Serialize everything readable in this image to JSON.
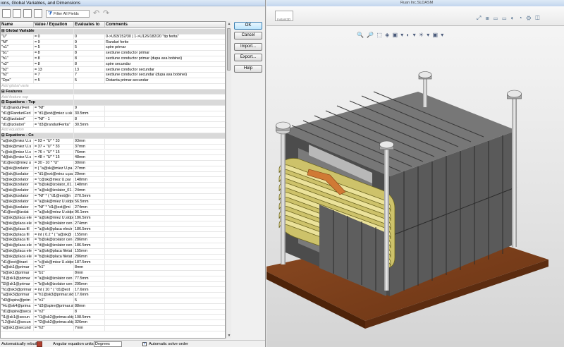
{
  "dialog": {
    "title": "ions, Global Variables, and Dimensions",
    "filter_placeholder": "Filter All Fields",
    "columns": [
      "Name",
      "Value / Equation",
      "Evaluates to",
      "Comments"
    ],
    "buttons": {
      "ok": "OK",
      "cancel": "Cancel",
      "import": "Import...",
      "export": "Export...",
      "help": "Help"
    },
    "bottom": {
      "automatic_label": "Automatically rebuild",
      "angular_units_label": "Angular equation units:",
      "angular_units_value": "Degrees",
      "auto_solve_label": "Automatic solve order"
    },
    "rows": [
      {
        "t": "section",
        "n": "Global Variable"
      },
      {
        "n": "\"U\"",
        "v": "= 0",
        "e": "0",
        "c": "0->U93/152/30 | 1->U126/182/20 \"tip ferita\""
      },
      {
        "n": "\"Nf\"",
        "v": "= 9",
        "e": "9",
        "c": "Randuri ferite"
      },
      {
        "n": "\"n1\"",
        "v": "= 5",
        "e": "5",
        "c": "spire primar"
      },
      {
        "n": "\"b1\"",
        "v": "= 8",
        "e": "8",
        "c": "sectiune conductor primar"
      },
      {
        "n": "\"h1\"",
        "v": "= 8",
        "e": "8",
        "c": "sectiune conductor primar (dupa axa bobinei)"
      },
      {
        "n": "\"n2\"",
        "v": "= 8",
        "e": "8",
        "c": "spire secundar"
      },
      {
        "n": "\"b2\"",
        "v": "= 13",
        "e": "13",
        "c": "sectiune conductor secundar"
      },
      {
        "n": "\"h2\"",
        "v": "= 7",
        "e": "7",
        "c": "sectiune conductor secundar (dupa axa bobinei)"
      },
      {
        "n": "\"Dps\"",
        "v": "= 5",
        "e": "5",
        "c": "Distanta primar-secundar"
      },
      {
        "t": "add",
        "n": "Add global varia"
      },
      {
        "t": "section",
        "n": "Features"
      },
      {
        "t": "add",
        "n": "Add feature sup"
      },
      {
        "t": "section",
        "n": "Equations - Top"
      },
      {
        "n": "\"d1@randuriFeri",
        "v": "= \"Nf\"",
        "e": "9",
        "c": ""
      },
      {
        "n": "\"d1@RanduriFeri",
        "v": "= \"d1@ext@miez u.sk",
        "e": "30.5mm",
        "c": ""
      },
      {
        "n": "\"d1@izolatori\"",
        "v": "= \"Nf\" - 1",
        "e": "8",
        "c": ""
      },
      {
        "n": "\"d1@izolatori\"",
        "v": "= \"d3@randuriFerita\"",
        "e": "30.5mm",
        "c": ""
      },
      {
        "t": "add",
        "n": "Add equation"
      },
      {
        "t": "section",
        "n": "Equations - Co"
      },
      {
        "n": "\"a@sk@miez U.s",
        "v": "= 93 + \"U\" * 33",
        "e": "93mm",
        "c": ""
      },
      {
        "n": "\"b@sk@miez U.s",
        "v": "= 37 + \"U\" * 33",
        "e": "37mm",
        "c": ""
      },
      {
        "n": "\"c@sk@miez U.s",
        "v": "= 76 + \"U\" * 15",
        "e": "76mm",
        "c": ""
      },
      {
        "n": "\"d@sk@miez U.s",
        "v": "= 48 + \"U\" * 15",
        "e": "48mm",
        "c": ""
      },
      {
        "n": "\"d1@ext@miez u",
        "v": "= 30 - 10 * \"U\"",
        "e": "30mm",
        "c": ""
      },
      {
        "n": "\"a@sk@izolator",
        "v": "= ( \"a@sk@miez U.pa",
        "e": "27mm",
        "c": ""
      },
      {
        "n": "\"b@sk@izolator",
        "v": "= \"d1@ext@miez u.pa",
        "e": "29mm",
        "c": ""
      },
      {
        "n": "\"b@sk@izolator",
        "v": "= \"c@sk@miez U.par",
        "e": "148mm",
        "c": ""
      },
      {
        "n": "\"b@sk@izolator",
        "v": "= \"b@sk@izolator_01.",
        "e": "148mm",
        "c": ""
      },
      {
        "n": "\"a@sk@izolator",
        "v": "= \"a@sk@izolator_01.",
        "e": "24mm",
        "c": ""
      },
      {
        "n": "\"a@sk@izolator",
        "v": "= \"Nf\" * ( \"d1@ext@n",
        "e": "270.5mm",
        "c": ""
      },
      {
        "n": "\"a@sk@izolator",
        "v": "= \"a@sk@miez U.sldpr",
        "e": "56.5mm",
        "c": ""
      },
      {
        "n": "\"b@sk@izolator",
        "v": "= \"Nf\" * \"d1@ext@mi",
        "e": "274mm",
        "c": ""
      },
      {
        "n": "\"d1@ext@izolat",
        "v": "= \"a@sk@miez U.sldpr",
        "e": "96.1mm",
        "c": ""
      },
      {
        "n": "\"a@sk@placa ele",
        "v": "= \"a@sk@miez U.sldpr",
        "e": "186.5mm",
        "c": ""
      },
      {
        "n": "\"b@sk@placa ele",
        "v": "= \"b@sk@izolator cen",
        "e": "274mm",
        "c": ""
      },
      {
        "n": "\"a@sk@placa fil",
        "v": "= \"a@sk@placa electr",
        "e": "186.5mm",
        "c": ""
      },
      {
        "n": "\"b@sk@placa fil",
        "v": "= int ( 0.2 * ( \"a@sk@",
        "e": "155mm",
        "c": ""
      },
      {
        "n": "\"b@sk@placa fil",
        "v": "= \"b@sk@izolator cen",
        "e": "286mm",
        "c": ""
      },
      {
        "n": "\"a@sk@placa ele",
        "v": "= \"d@sk@izolator cen",
        "e": "186.5mm",
        "c": ""
      },
      {
        "n": "\"a@sk@placa ele",
        "v": "= \"a@sk@placa filetat",
        "e": "155mm",
        "c": ""
      },
      {
        "n": "\"b@sk@placa ele",
        "v": "= \"b@sk@placa filetat",
        "e": "286mm",
        "c": ""
      },
      {
        "n": "\"d1@ext@trant",
        "v": "= \"c@sk@miez U.sldpr",
        "e": "187.5mm",
        "c": ""
      },
      {
        "n": "\"a@sk1@primar",
        "v": "= \"h1\"",
        "e": "8mm",
        "c": ""
      },
      {
        "n": "\"b@sk1@primar",
        "v": "= \"b1\"",
        "e": "8mm",
        "c": ""
      },
      {
        "n": "\"i1@sk1@primar",
        "v": "= \"a@sk@izolator cen",
        "e": "77.5mm",
        "c": ""
      },
      {
        "n": "\"l2@sk1@primar",
        "v": "= \"b@sk@izolator cen",
        "e": "295mm",
        "c": ""
      },
      {
        "n": "\"h1@sk3@primar",
        "v": "= int ( 10 * ( \"d1@ext",
        "e": "17.6mm",
        "c": ""
      },
      {
        "n": "\"a@sk3@primar",
        "v": "= \"h1@sk3@primar.sld",
        "e": "17.6mm",
        "c": ""
      },
      {
        "n": "\"d3@spire@prim",
        "v": "= \"n1\"",
        "e": "5",
        "c": ""
      },
      {
        "n": "\"Hc@sk4@prima",
        "v": "= \"d3@spire@primar.sl",
        "e": "88mm",
        "c": ""
      },
      {
        "n": "\"d1@spire@secu",
        "v": "= \"n2\"",
        "e": "8",
        "c": ""
      },
      {
        "n": "\"l1@sk1@secun",
        "v": "= \"i1@sk2@primar.sldp",
        "e": "108.5mm",
        "c": ""
      },
      {
        "n": "\"L2@sk1@secun",
        "v": "= \"l2@sk2@primar.sldp",
        "e": "326mm",
        "c": ""
      },
      {
        "n": "\"a@sk1@secund",
        "v": "= \"h2\"",
        "e": "7mm",
        "c": ""
      }
    ]
  },
  "cad": {
    "window_title": "Ruan Inc.SLDASM",
    "tab_label": "Instant3D",
    "ribbon_icons": "⤢ ⊞ ▭ ▭ ◐ ◔ ⚙ ◫",
    "view_icons": "🔍 🔎 ⬚ ◈ ▣ ▾ ◐ ▾ ☀ ▾ ▣ ▾"
  },
  "colors": {
    "core": "#5c5c5c",
    "coil": "#e6dd8a",
    "base": "#7a3d18",
    "primary_bar": "#d07a35"
  }
}
